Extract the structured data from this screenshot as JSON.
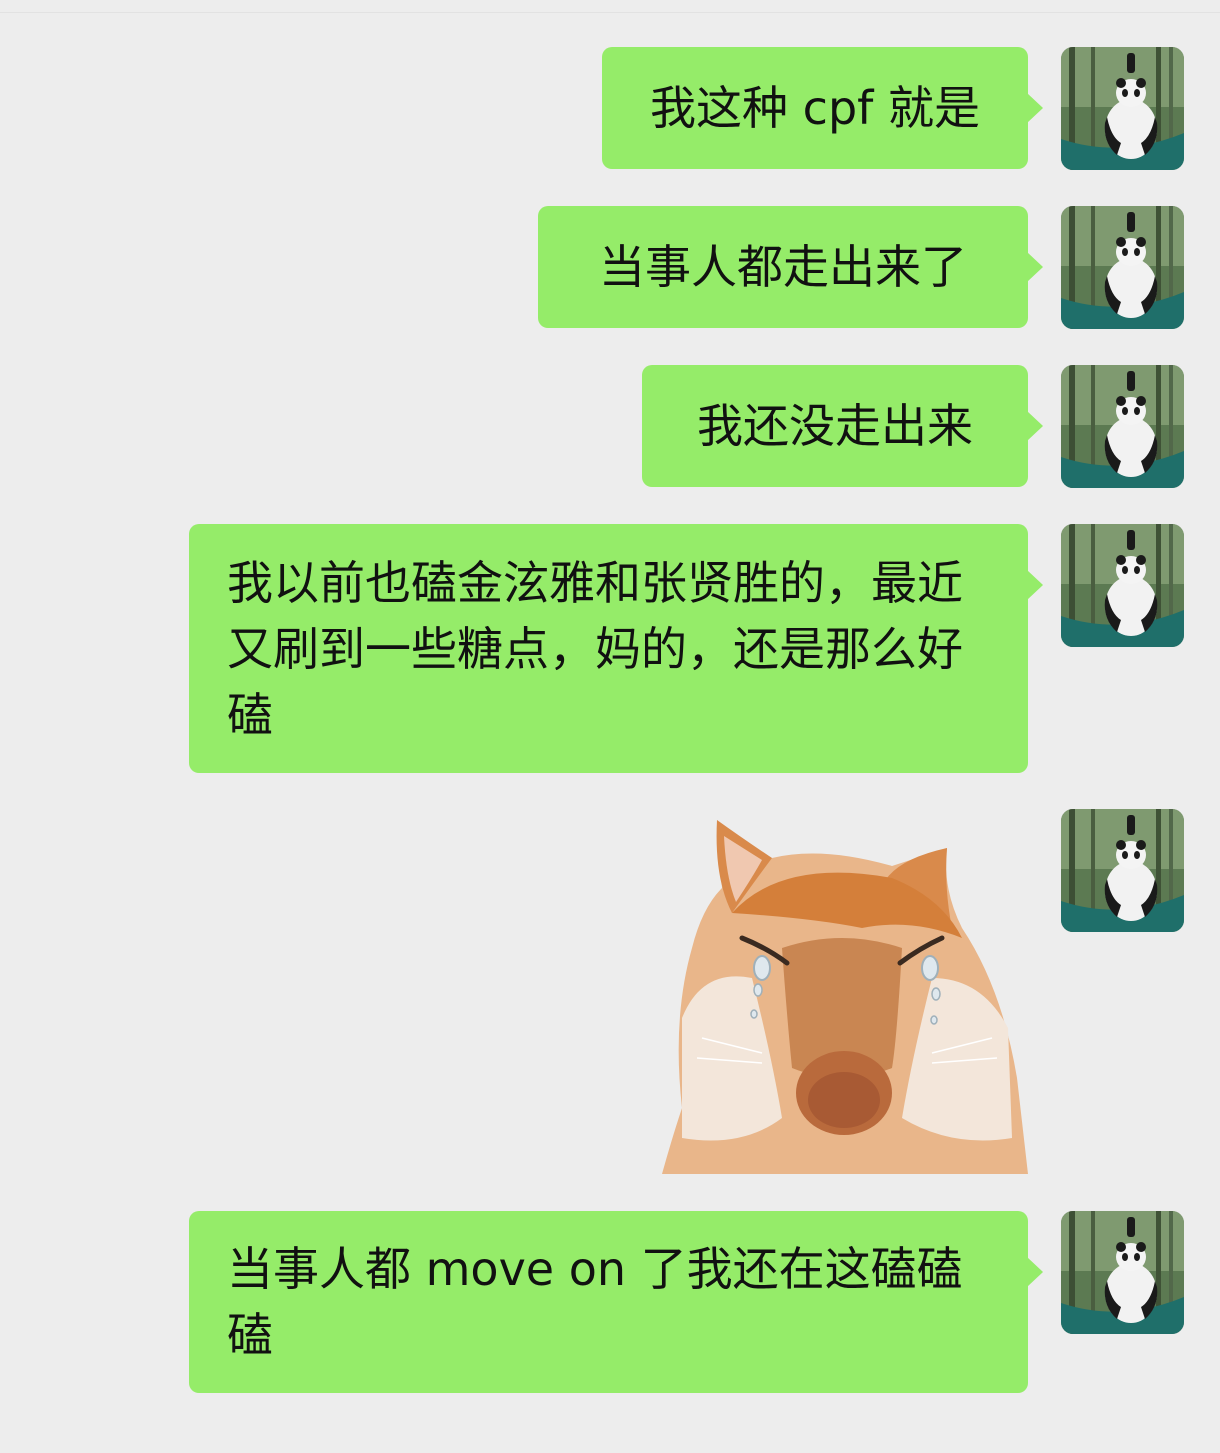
{
  "chat": {
    "messages": [
      {
        "text": "我这种 cpf 就是"
      },
      {
        "text": "当事人都走出来了"
      },
      {
        "text": "我还没走出来"
      },
      {
        "text": "我以前也磕金泫雅和张贤胜的，最近又刷到一些糖点，妈的，还是那么好磕"
      },
      {
        "sticker": "crying-cat-sticker"
      },
      {
        "text": "当事人都 move on 了我还在这磕磕磕"
      }
    ]
  },
  "colors": {
    "background": "#ededed",
    "bubble": "#95ec69",
    "text": "#111111"
  }
}
